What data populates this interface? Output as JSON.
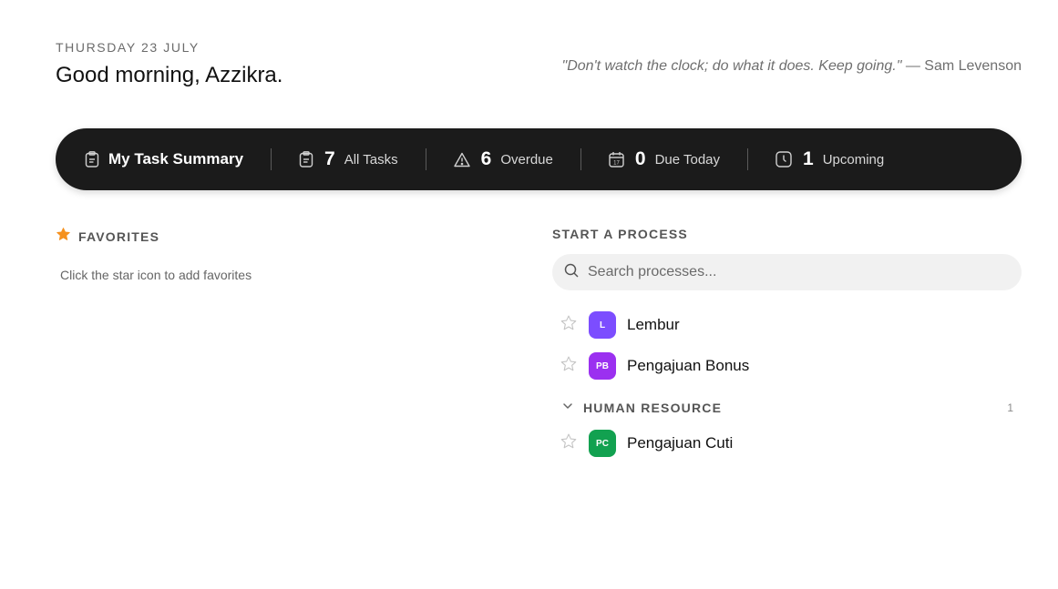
{
  "header": {
    "date": "THURSDAY 23 JULY",
    "greeting": "Good morning, Azzikra.",
    "quote_text": "\"Don't watch the clock; do what it does. Keep going.\"",
    "quote_author": " — Sam Levenson"
  },
  "summary": {
    "title": "My Task Summary",
    "all_tasks": {
      "count": "7",
      "label": "All Tasks",
      "icon": "clipboard-icon"
    },
    "overdue": {
      "count": "6",
      "label": "Overdue",
      "icon": "warning-icon"
    },
    "due_today": {
      "count": "0",
      "label": "Due Today",
      "icon": "calendar-icon"
    },
    "upcoming": {
      "count": "1",
      "label": "Upcoming",
      "icon": "clock-icon"
    }
  },
  "favorites": {
    "title": "FAVORITES",
    "hint": "Click the star icon to add favorites",
    "icon_color": "#f5911e"
  },
  "processes": {
    "title": "START A PROCESS",
    "search_placeholder": "Search processes...",
    "items": [
      {
        "initials": "L",
        "name": "Lembur",
        "color": "#7c4dff"
      },
      {
        "initials": "PB",
        "name": "Pengajuan Bonus",
        "color": "#9b30f0"
      }
    ],
    "groups": [
      {
        "name": "HUMAN RESOURCE",
        "count": "1",
        "items": [
          {
            "initials": "PC",
            "name": "Pengajuan Cuti",
            "color": "#12a150"
          }
        ]
      }
    ]
  },
  "colors": {
    "summary_bg": "#1b1b1b",
    "accent_star": "#f5911e"
  }
}
